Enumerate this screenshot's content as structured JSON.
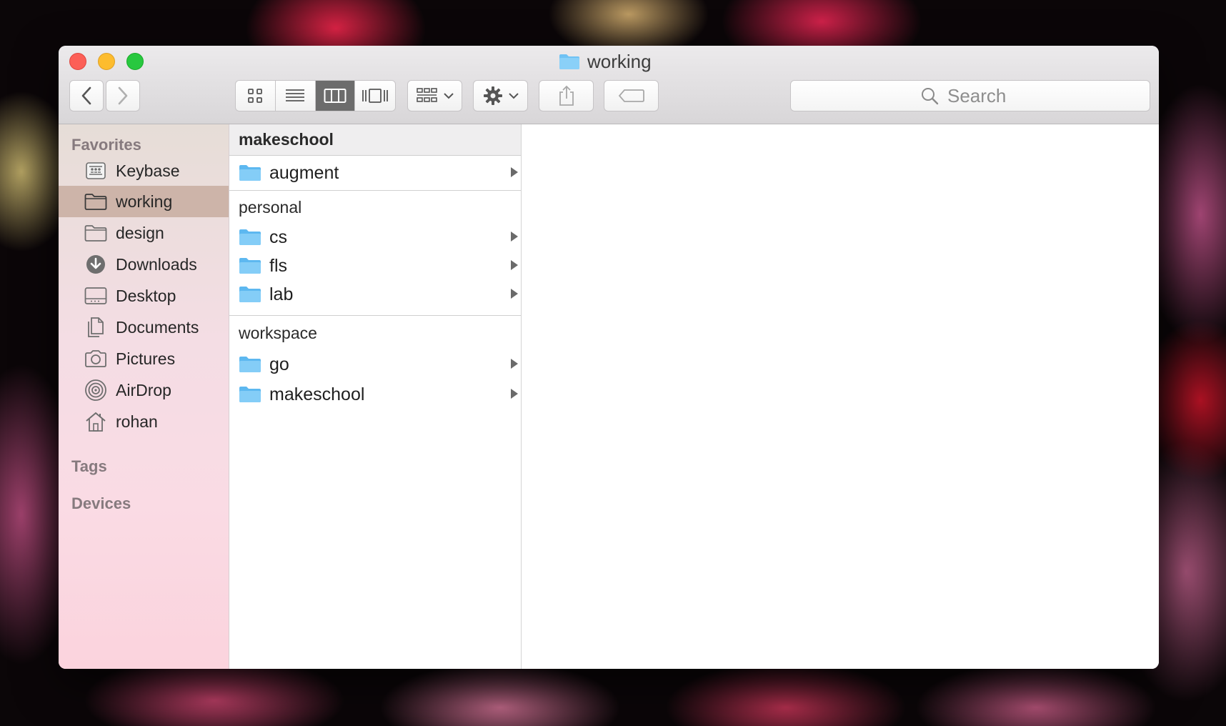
{
  "window": {
    "title": "working",
    "colors": {
      "close": "#fc5f57",
      "minimize": "#fdbc2e",
      "zoom": "#28c83f",
      "folder": "#6fc2f4"
    }
  },
  "toolbar": {
    "back_icon": "chevron-left-icon",
    "forward_icon": "chevron-right-icon",
    "view_modes": [
      "icon-view",
      "list-view",
      "column-view",
      "cover-flow-view"
    ],
    "active_view": "column-view",
    "arrange_icon": "grid-dropdown-icon",
    "action_icon": "gear-dropdown-icon",
    "share_icon": "share-icon",
    "tag_icon": "tag-icon",
    "search_placeholder": "Search"
  },
  "sidebar": {
    "favorites_label": "Favorites",
    "items": [
      {
        "label": "Keybase",
        "icon": "keybase-drive-icon"
      },
      {
        "label": "working",
        "icon": "folder-icon",
        "selected": true
      },
      {
        "label": "design",
        "icon": "folder-icon"
      },
      {
        "label": "Downloads",
        "icon": "downloads-icon"
      },
      {
        "label": "Desktop",
        "icon": "desktop-icon"
      },
      {
        "label": "Documents",
        "icon": "documents-icon"
      },
      {
        "label": "Pictures",
        "icon": "camera-icon"
      },
      {
        "label": "AirDrop",
        "icon": "airdrop-icon"
      },
      {
        "label": "rohan",
        "icon": "home-icon"
      }
    ],
    "tags_label": "Tags",
    "devices_label": "Devices"
  },
  "column": {
    "groups": [
      {
        "header": "makeschool",
        "items": [
          "augment"
        ]
      },
      {
        "header": "personal",
        "items": [
          "cs",
          "fls",
          "lab"
        ]
      },
      {
        "header": "workspace",
        "items": [
          "go",
          "makeschool"
        ]
      }
    ]
  }
}
